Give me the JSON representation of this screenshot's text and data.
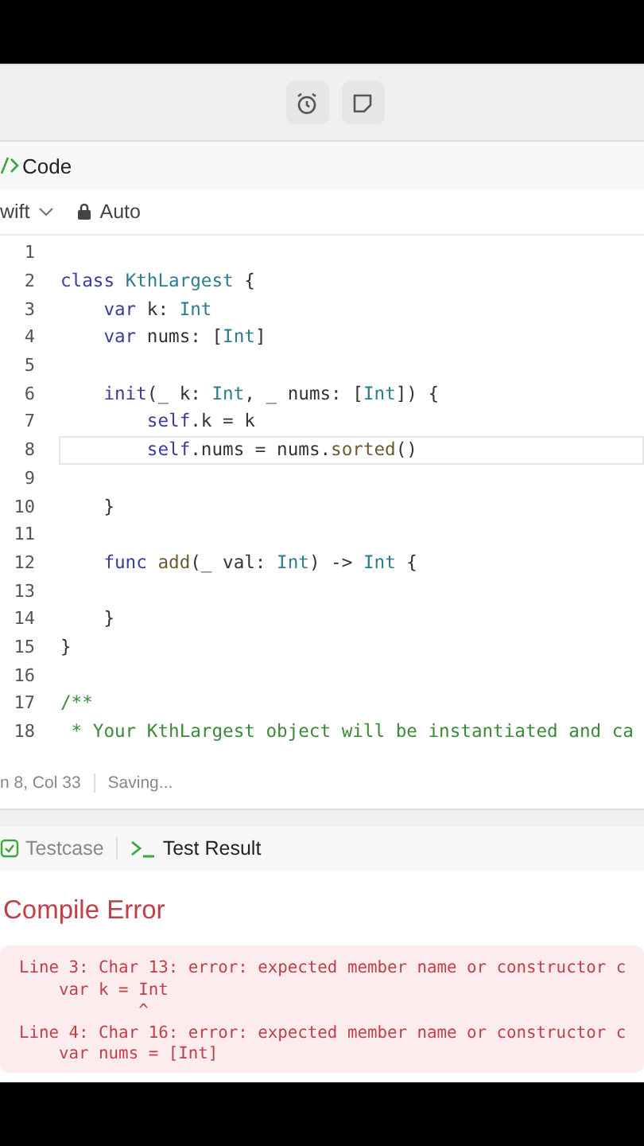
{
  "toolbar": {
    "buttons": [
      {
        "kind": "alarm"
      },
      {
        "kind": "note"
      }
    ]
  },
  "code_panel": {
    "title": "Code",
    "language": "wift",
    "mode": "Auto"
  },
  "editor": {
    "lines": [
      {
        "number": "1",
        "active": false
      },
      {
        "number": "2",
        "active": false,
        "tokens": [
          {
            "kind": "kw",
            "text": "class "
          },
          {
            "kind": "type",
            "text": "KthLargest"
          },
          {
            "kind": "plain",
            "text": " {"
          }
        ]
      },
      {
        "number": "3",
        "active": false,
        "tokens": [
          {
            "kind": "kw",
            "text": "    var "
          },
          {
            "kind": "plain",
            "text": "k: "
          },
          {
            "kind": "type",
            "text": "Int"
          }
        ]
      },
      {
        "number": "4",
        "active": false,
        "tokens": [
          {
            "kind": "kw",
            "text": "    var "
          },
          {
            "kind": "plain",
            "text": "nums: ["
          },
          {
            "kind": "type",
            "text": "Int"
          },
          {
            "kind": "plain",
            "text": "]"
          }
        ]
      },
      {
        "number": "5",
        "active": false
      },
      {
        "number": "6",
        "active": false,
        "tokens": [
          {
            "kind": "kw",
            "text": "    init"
          },
          {
            "kind": "plain",
            "text": "(_ k: "
          },
          {
            "kind": "type",
            "text": "Int"
          },
          {
            "kind": "plain",
            "text": ", _ nums: ["
          },
          {
            "kind": "type",
            "text": "Int"
          },
          {
            "kind": "plain",
            "text": "]) {"
          }
        ]
      },
      {
        "number": "7",
        "active": false,
        "tokens": [
          {
            "kind": "kw",
            "text": "        self"
          },
          {
            "kind": "plain",
            "text": ".k = k"
          }
        ]
      },
      {
        "number": "8",
        "active": true,
        "tokens": [
          {
            "kind": "kw",
            "text": "        self"
          },
          {
            "kind": "plain",
            "text": ".nums = nums."
          },
          {
            "kind": "fn",
            "text": "sorted"
          },
          {
            "kind": "plain",
            "text": "()"
          }
        ]
      },
      {
        "number": "9",
        "active": false
      },
      {
        "number": "10",
        "active": false,
        "tokens": [
          {
            "kind": "plain",
            "text": "    }"
          }
        ]
      },
      {
        "number": "11",
        "active": false
      },
      {
        "number": "12",
        "active": false,
        "tokens": [
          {
            "kind": "kw",
            "text": "    func "
          },
          {
            "kind": "fn",
            "text": "add"
          },
          {
            "kind": "plain",
            "text": "(_ val: "
          },
          {
            "kind": "type",
            "text": "Int"
          },
          {
            "kind": "plain",
            "text": ") -> "
          },
          {
            "kind": "type",
            "text": "Int"
          },
          {
            "kind": "plain",
            "text": " {"
          }
        ]
      },
      {
        "number": "13",
        "active": false
      },
      {
        "number": "14",
        "active": false,
        "tokens": [
          {
            "kind": "plain",
            "text": "    }"
          }
        ]
      },
      {
        "number": "15",
        "active": false,
        "tokens": [
          {
            "kind": "plain",
            "text": "}"
          }
        ]
      },
      {
        "number": "16",
        "active": false
      },
      {
        "number": "17",
        "active": false,
        "tokens": [
          {
            "kind": "comment",
            "text": "/**"
          }
        ]
      },
      {
        "number": "18",
        "active": false,
        "tokens": [
          {
            "kind": "comment",
            "text": " * Your KthLargest object will be instantiated and ca"
          }
        ]
      }
    ]
  },
  "status_bar": {
    "position": "n 8, Col 33",
    "state": "Saving..."
  },
  "result_tabs": [
    {
      "label": "Testcase",
      "kind": "testcase",
      "selected": false
    },
    {
      "label": "Test Result",
      "kind": "terminal",
      "selected": true
    }
  ],
  "result": {
    "title": "Compile Error",
    "lines": [
      "Line 3: Char 13: error: expected member name or constructor c",
      "    var k = Int",
      "            ^",
      "Line 4: Char 16: error: expected member name or constructor c",
      "    var nums = [Int]"
    ]
  }
}
